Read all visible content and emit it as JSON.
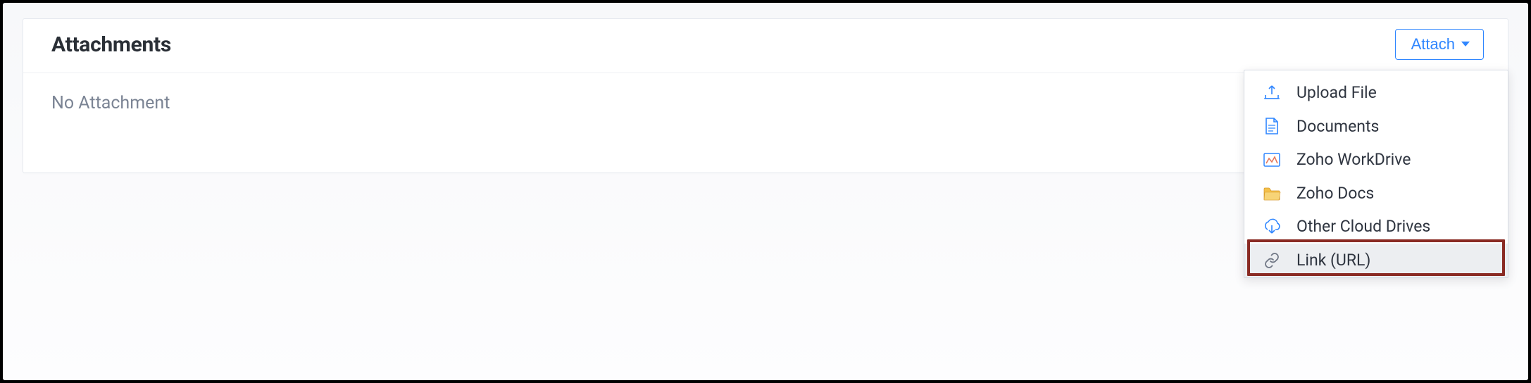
{
  "panel": {
    "title": "Attachments",
    "empty_text": "No Attachment",
    "attach_button_label": "Attach"
  },
  "menu": {
    "items": [
      {
        "id": "upload-file",
        "label": "Upload File",
        "icon": "upload-file-icon"
      },
      {
        "id": "documents",
        "label": "Documents",
        "icon": "documents-icon"
      },
      {
        "id": "zoho-workdrive",
        "label": "Zoho WorkDrive",
        "icon": "workdrive-icon"
      },
      {
        "id": "zoho-docs",
        "label": "Zoho Docs",
        "icon": "folder-icon"
      },
      {
        "id": "other-cloud-drives",
        "label": "Other Cloud Drives",
        "icon": "cloud-download-icon"
      },
      {
        "id": "link-url",
        "label": "Link (URL)",
        "icon": "link-icon"
      }
    ],
    "highlighted_index": 5
  },
  "colors": {
    "accent": "#2f86ff",
    "highlight_ring": "#8a2b24"
  }
}
